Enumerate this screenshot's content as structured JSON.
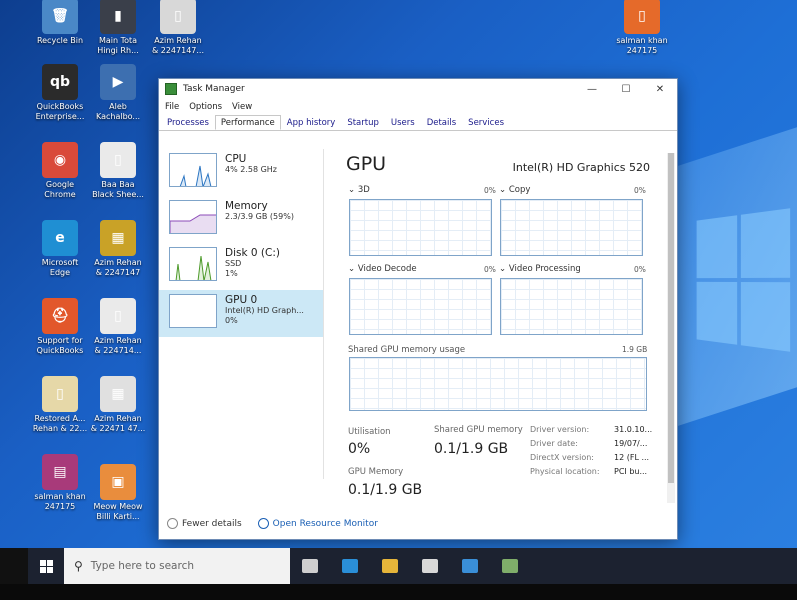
{
  "desktop": {
    "icons": [
      {
        "label": "Recycle Bin",
        "glyph": "🗑",
        "color": "#4a88c7"
      },
      {
        "label": "Main Tota\nHingi Rh...",
        "glyph": "▮",
        "color": "#3a3f4a"
      },
      {
        "label": "Azim Rehan\n& 2247147...",
        "glyph": "▯",
        "color": "#d8d8d8"
      },
      {
        "label": "QuickBooks\nEnterprise...",
        "glyph": "qb",
        "color": "#2b2b2b"
      },
      {
        "label": "Aleb\nKachalbo...",
        "glyph": "▶",
        "color": "#3d6fb0"
      },
      {
        "label": "Google\nChrome",
        "glyph": "◉",
        "color": "#d94a3a"
      },
      {
        "label": "Baa Baa\nBlack Shee...",
        "glyph": "▯",
        "color": "#eaeaea"
      },
      {
        "label": "Microsoft\nEdge",
        "glyph": "e",
        "color": "#1f8fd3"
      },
      {
        "label": "Azim Rehan\n& 2247147",
        "glyph": "▦",
        "color": "#c9a227"
      },
      {
        "label": "Support for\nQuickBooks",
        "glyph": "⛑",
        "color": "#e2572b"
      },
      {
        "label": "Azim Rehan\n& 224714...",
        "glyph": "▯",
        "color": "#eaeaea"
      },
      {
        "label": "Restored A...\nRehan & 22...",
        "glyph": "▯",
        "color": "#e6d8a8"
      },
      {
        "label": "Azim Rehan\n& 22471 47...",
        "glyph": "▦",
        "color": "#e0e0e0"
      },
      {
        "label": "salman khan\n247175",
        "glyph": "▤",
        "color": "#a83a7a"
      },
      {
        "label": "Meow Meow\nBilli Karti...",
        "glyph": "▣",
        "color": "#e98d3d"
      },
      {
        "label": "salman khan\n247175",
        "glyph": "▯",
        "color": "#e56a2a"
      }
    ]
  },
  "window": {
    "title": "Task Manager",
    "menu": [
      "File",
      "Options",
      "View"
    ],
    "tabs": [
      "Processes",
      "Performance",
      "App history",
      "Startup",
      "Users",
      "Details",
      "Services"
    ],
    "active_tab": "Performance",
    "controls": {
      "minimize": "—",
      "maximize": "☐",
      "close": "✕"
    }
  },
  "sidebar": {
    "items": [
      {
        "name": "CPU",
        "sub1": "4% 2.58 GHz",
        "sub2": ""
      },
      {
        "name": "Memory",
        "sub1": "2.3/3.9 GB (59%)",
        "sub2": ""
      },
      {
        "name": "Disk 0 (C:)",
        "sub1": "SSD",
        "sub2": "1%"
      },
      {
        "name": "GPU 0",
        "sub1": "Intel(R) HD Graph...",
        "sub2": "0%"
      }
    ]
  },
  "gpu": {
    "heading": "GPU",
    "model": "Intel(R) HD Graphics 520",
    "engines": [
      {
        "label": "3D",
        "pct": "0%"
      },
      {
        "label": "Copy",
        "pct": "0%"
      },
      {
        "label": "Video Decode",
        "pct": "0%"
      },
      {
        "label": "Video Processing",
        "pct": "0%"
      }
    ],
    "shared_memory": {
      "label": "Shared GPU memory usage",
      "max": "1.9 GB"
    },
    "stats": {
      "utilisation_label": "Utilisation",
      "utilisation_value": "0%",
      "shared_label": "Shared GPU memory",
      "shared_value": "0.1/1.9 GB",
      "gpu_memory_label": "GPU Memory",
      "gpu_memory_value": "0.1/1.9 GB"
    },
    "details": [
      {
        "k": "Driver version:",
        "v": "31.0.10..."
      },
      {
        "k": "Driver date:",
        "v": "19/07/..."
      },
      {
        "k": "DirectX version:",
        "v": "12 (FL ..."
      },
      {
        "k": "Physical location:",
        "v": "PCI bu..."
      }
    ]
  },
  "footer": {
    "fewer": "Fewer details",
    "monitor": "Open Resource Monitor"
  },
  "taskbar": {
    "search_placeholder": "Type here to search",
    "apps": [
      {
        "name": "task-view",
        "color": "#cfcfcf"
      },
      {
        "name": "edge",
        "color": "#2a8fd8"
      },
      {
        "name": "file-explorer",
        "color": "#e5b53a"
      },
      {
        "name": "store",
        "color": "#d8d8d8"
      },
      {
        "name": "mail",
        "color": "#3a8fd8"
      },
      {
        "name": "task-manager",
        "color": "#7fae6a"
      }
    ]
  }
}
